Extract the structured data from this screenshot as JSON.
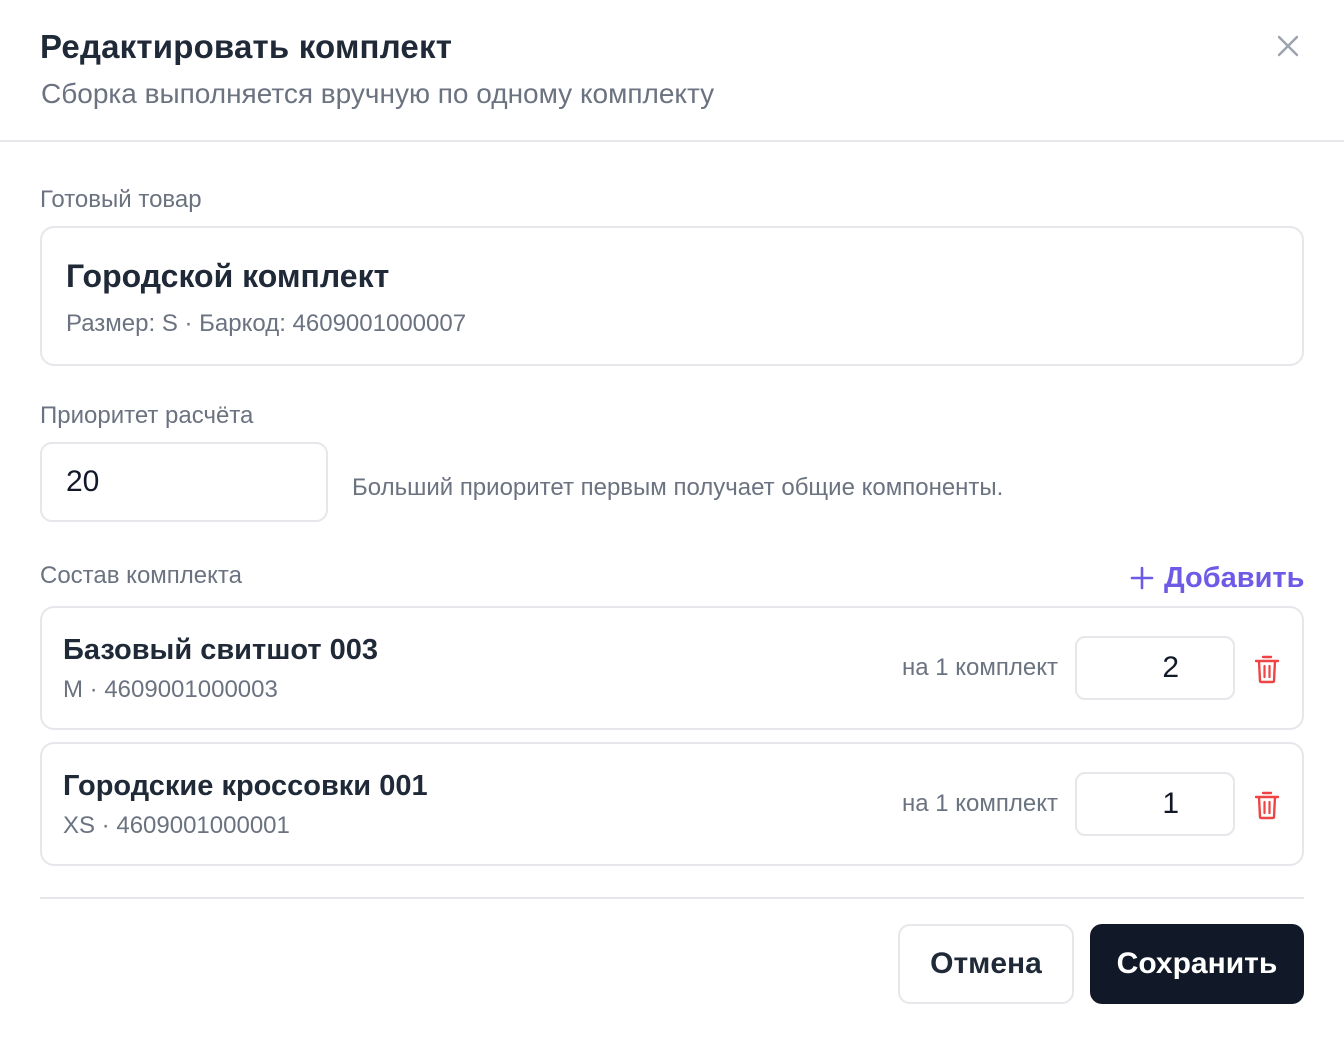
{
  "dialog": {
    "title": "Редактировать комплект",
    "subtitle": "Сборка выполняется вручную по одному комплекту"
  },
  "finished_product": {
    "label": "Готовый товар",
    "name": "Городской комплект",
    "meta": "Размер: S · Баркод: 4609001000007"
  },
  "priority": {
    "label": "Приоритет расчёта",
    "value": "20",
    "hint": "Больший приоритет первым получает общие компоненты."
  },
  "composition": {
    "label": "Состав комплекта",
    "add_label": "Добавить",
    "items": [
      {
        "name": "Базовый свитшот 003",
        "meta": "M · 4609001000003",
        "per_kit_label": "на 1 комплект",
        "quantity": "2"
      },
      {
        "name": "Городские кроссовки 001",
        "meta": "XS · 4609001000001",
        "per_kit_label": "на 1 комплект",
        "quantity": "1"
      }
    ]
  },
  "footer": {
    "cancel_label": "Отмена",
    "save_label": "Сохранить"
  },
  "colors": {
    "accent": "#6d5ae6",
    "danger": "#ef4444",
    "primary_button": "#111827",
    "border": "#e5e7eb",
    "muted_text": "#6b7280"
  },
  "icons": {
    "close": "close-icon",
    "add": "plus-icon",
    "delete": "trash-icon"
  }
}
